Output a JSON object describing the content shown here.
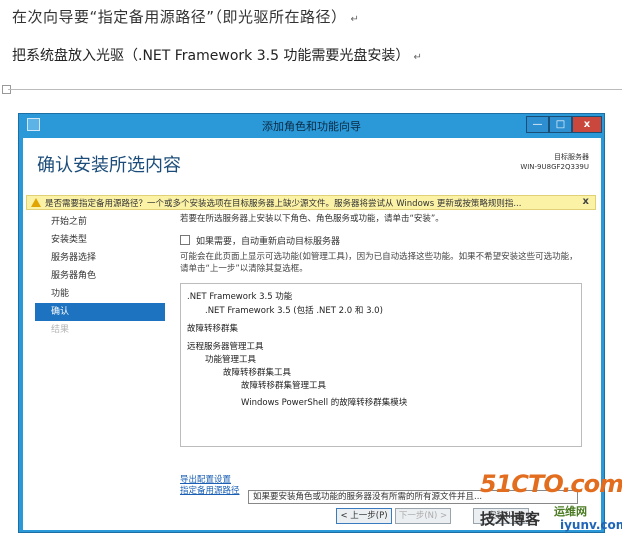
{
  "document": {
    "line1": "在次向导要“指定备用源路径”（即光驱所在路径）",
    "line2": "把系统盘放入光驱（.NET Framework 3.5    功能需要光盘安装）",
    "paragraph_mark": "↵"
  },
  "window": {
    "title": "添加角色和功能向导",
    "controls": {
      "minimize": "—",
      "maximize": "□",
      "close": "x"
    },
    "heading": "确认安装所选内容",
    "target_server_label": "目标服务器",
    "target_server_name": "WIN-9U8GF2Q339U",
    "warning": {
      "text": "是否需要指定备用源路径？一个或多个安装选项在目标服务器上缺少源文件。服务器将尝试从 Windows 更新或按策略规则指...",
      "close_label": "x"
    },
    "nav": [
      {
        "label": "开始之前",
        "state": "normal"
      },
      {
        "label": "安装类型",
        "state": "normal"
      },
      {
        "label": "服务器选择",
        "state": "normal"
      },
      {
        "label": "服务器角色",
        "state": "normal"
      },
      {
        "label": "功能",
        "state": "normal"
      },
      {
        "label": "确认",
        "state": "active"
      },
      {
        "label": "结果",
        "state": "disabled"
      }
    ],
    "intro": "若要在所选服务器上安装以下角色、角色服务或功能，请单击“安装”。",
    "restart_checkbox_label": "如果需要，自动重新启动目标服务器",
    "note": "可能会在此页面上显示可选功能(如管理工具)，因为已自动选择这些功能。如果不希望安装这些可选功能，请单击“上一步”以清除其复选框。",
    "features": [
      ".NET Framework 3.5 功能",
      ".NET Framework 3.5 (包括 .NET 2.0 和 3.0)",
      "故障转移群集",
      "远程服务器管理工具",
      "功能管理工具",
      "故障转移群集工具",
      "故障转移群集管理工具",
      "Windows PowerShell 的故障转移群集模块"
    ],
    "links": {
      "export": "导出配置设置",
      "alt_source": "指定备用源路径"
    },
    "tooltip": "如果要安装角色或功能的服务器没有所需的所有源文件并且...",
    "buttons": {
      "previous": "< 上一步(P)",
      "next": "下一步(N) >",
      "install": "安装(I)"
    }
  },
  "watermark": {
    "main": "51CTO.com",
    "sub": "技术博客",
    "tag": "运维网",
    "url": "iyunv.com"
  },
  "colors": {
    "window_frame": "#2b98d8",
    "heading": "#1c4d7a",
    "nav_active": "#1e73c1",
    "warning_bg": "#fbf2a6",
    "link": "#1a5fb4"
  }
}
